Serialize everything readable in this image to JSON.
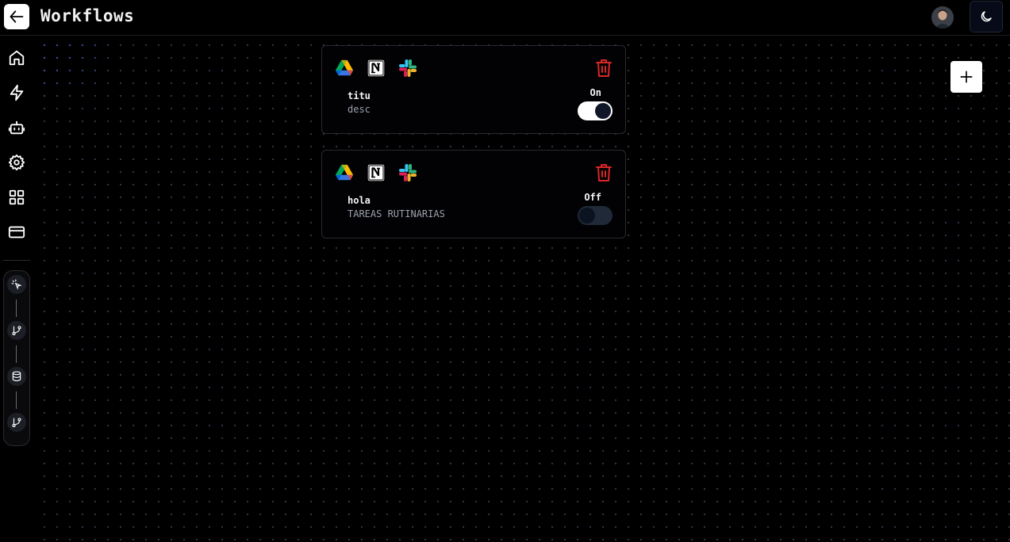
{
  "header": {
    "title": "Workflows",
    "back_icon": "arrow-left-icon",
    "avatar_icon": "user-avatar",
    "theme_icon": "moon-icon"
  },
  "sidebar": {
    "items": [
      {
        "name": "home",
        "icon": "home-icon"
      },
      {
        "name": "workflows",
        "icon": "lightning-icon"
      },
      {
        "name": "automations",
        "icon": "robot-icon"
      },
      {
        "name": "settings",
        "icon": "gear-icon"
      },
      {
        "name": "connections",
        "icon": "grid-icon"
      },
      {
        "name": "billing",
        "icon": "credit-card-icon"
      }
    ],
    "steps": [
      {
        "icon": "sparkle-click-icon"
      },
      {
        "icon": "git-branch-icon"
      },
      {
        "icon": "database-icon"
      },
      {
        "icon": "git-branch-icon"
      }
    ]
  },
  "workflows": [
    {
      "name": "titu",
      "description": "desc",
      "status_label": "On",
      "enabled": true,
      "apps": [
        "google-drive-icon",
        "notion-icon",
        "slack-icon"
      ]
    },
    {
      "name": "hola",
      "description": "TAREAS RUTINARIAS",
      "status_label": "Off",
      "enabled": false,
      "apps": [
        "google-drive-icon",
        "notion-icon",
        "slack-icon"
      ]
    }
  ],
  "actions": {
    "add_icon": "plus-icon",
    "delete_icon": "trash-icon"
  },
  "colors": {
    "background": "#000000",
    "delete": "#dc2626",
    "toggle_on": "#ffffff",
    "toggle_off": "#1f2937"
  }
}
